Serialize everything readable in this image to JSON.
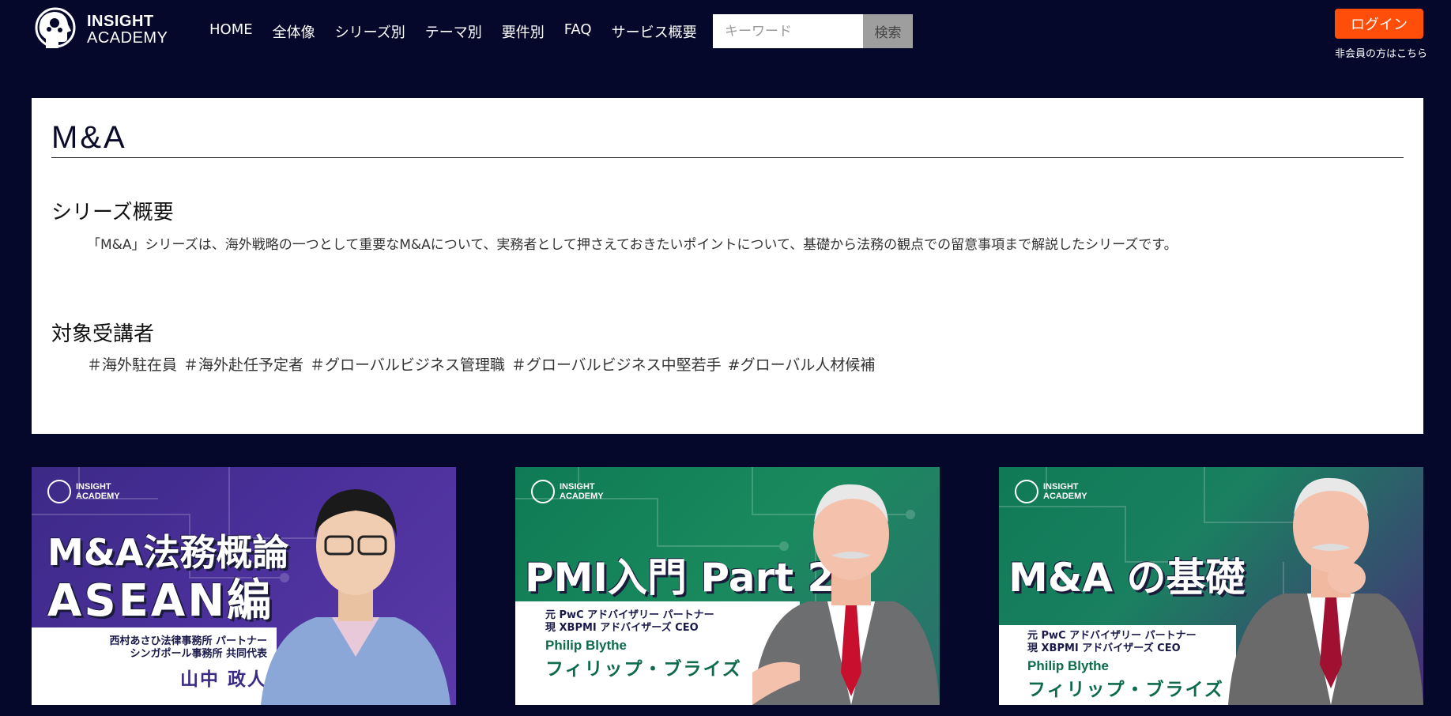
{
  "header": {
    "logo_line1": "INSIGHT",
    "logo_line2": "ACADEMY",
    "nav": [
      "HOME",
      "全体像",
      "シリーズ別",
      "テーマ別",
      "要件別",
      "FAQ",
      "サービス概要"
    ],
    "search_placeholder": "キーワード",
    "search_button": "検索",
    "login_button": "ログイン",
    "nonmember_link": "非会員の方はこちら"
  },
  "page": {
    "title": "M&A",
    "overview_heading": "シリーズ概要",
    "overview_text": "「M&A」シリーズは、海外戦略の一つとして重要なM&Aについて、実務者として押さえておきたいポイントについて、基礎から法務の観点での留意事項まで解説したシリーズです。",
    "audience_heading": "対象受講者",
    "audience_tags": [
      "＃海外駐在員",
      "＃海外赴任予定者",
      "＃グローバルビジネス管理職",
      "＃グローバルビジネス中堅若手",
      "#グローバル人材候補"
    ]
  },
  "thumbnails": [
    {
      "logo_line1": "INSIGHT",
      "logo_line2": "ACADEMY",
      "title_line1": "M&A法務概論",
      "title_line2": "ASEAN編",
      "role_line1": "西村あさひ法律事務所 パートナー",
      "role_line2": "シンガポール事務所 共同代表",
      "name": "山中 政人"
    },
    {
      "logo_line1": "INSIGHT",
      "logo_line2": "ACADEMY",
      "title_line1": "PMI入門 Part 2",
      "role_line1": "元 PwC アドバイザリー パートナー",
      "role_line2": "現 XBPMI アドバイザーズ CEO",
      "name_en": "Philip Blythe",
      "name": "フィリップ・ブライズ"
    },
    {
      "logo_line1": "INSIGHT",
      "logo_line2": "ACADEMY",
      "title_line1": "M&A の基礎",
      "role_line1": "元 PwC アドバイザリー パートナー",
      "role_line2": "現 XBPMI アドバイザーズ CEO",
      "name_en": "Philip Blythe",
      "name": "フィリップ・ブライズ"
    }
  ]
}
